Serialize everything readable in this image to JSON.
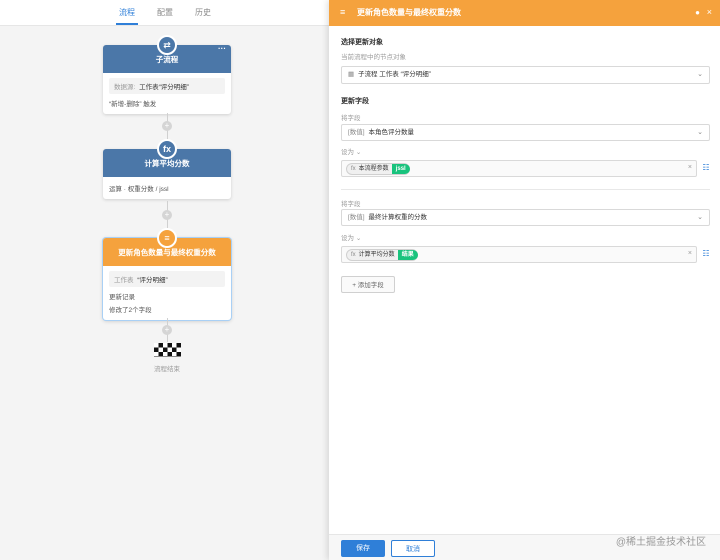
{
  "tabs": [
    {
      "label": "流程",
      "active": true
    },
    {
      "label": "配置",
      "active": false
    },
    {
      "label": "历史",
      "active": false
    }
  ],
  "nodes": {
    "subflow": {
      "title": "子流程",
      "icon": "subflow-icon",
      "data_source_label": "数据源:",
      "data_source_value": "工作表“评分明细”",
      "trigger": "“新增-删除” 触发"
    },
    "calc": {
      "title": "计算平均分数",
      "icon": "fx-icon",
      "op": "运算 · 权重分数 / jssl"
    },
    "update": {
      "title": "更新角色数量与最终权重分数",
      "icon": "update-record-icon",
      "sheet_label": "工作表",
      "sheet_value": "“评分明细”",
      "line1": "更新记录",
      "line2": "修改了2个字段"
    },
    "end": {
      "label": "流程结束"
    }
  },
  "panel": {
    "title": "更新角色数量与最终权重分数",
    "select_target": {
      "title": "选择更新对象",
      "hint": "当前流程中的节点对象",
      "prefix": "子流程",
      "value": "工作表 “评分明细”"
    },
    "update_fields": {
      "title": "更新字段",
      "fields": [
        {
          "field_label": "将字段",
          "field_type": "[数值]",
          "field_name": "本角色评分数量",
          "set_label": "设为",
          "token_icon": "fx",
          "token_text": "本流程参数",
          "token_tag": "jssl"
        },
        {
          "field_label": "将字段",
          "field_type": "[数值]",
          "field_name": "最终计算权重的分数",
          "set_label": "设为",
          "token_icon": "fx",
          "token_text": "计算平均分数",
          "token_tag": "结果"
        }
      ],
      "add_field": "+ 添加字段"
    },
    "footer": {
      "save": "保存",
      "cancel": "取消"
    }
  },
  "watermark": "@稀土掘金技术社区",
  "colors": {
    "orange": "#f5a23d",
    "blue_node": "#4b77a8",
    "primary": "#2f7fd8",
    "green_tag": "#19c37d"
  }
}
